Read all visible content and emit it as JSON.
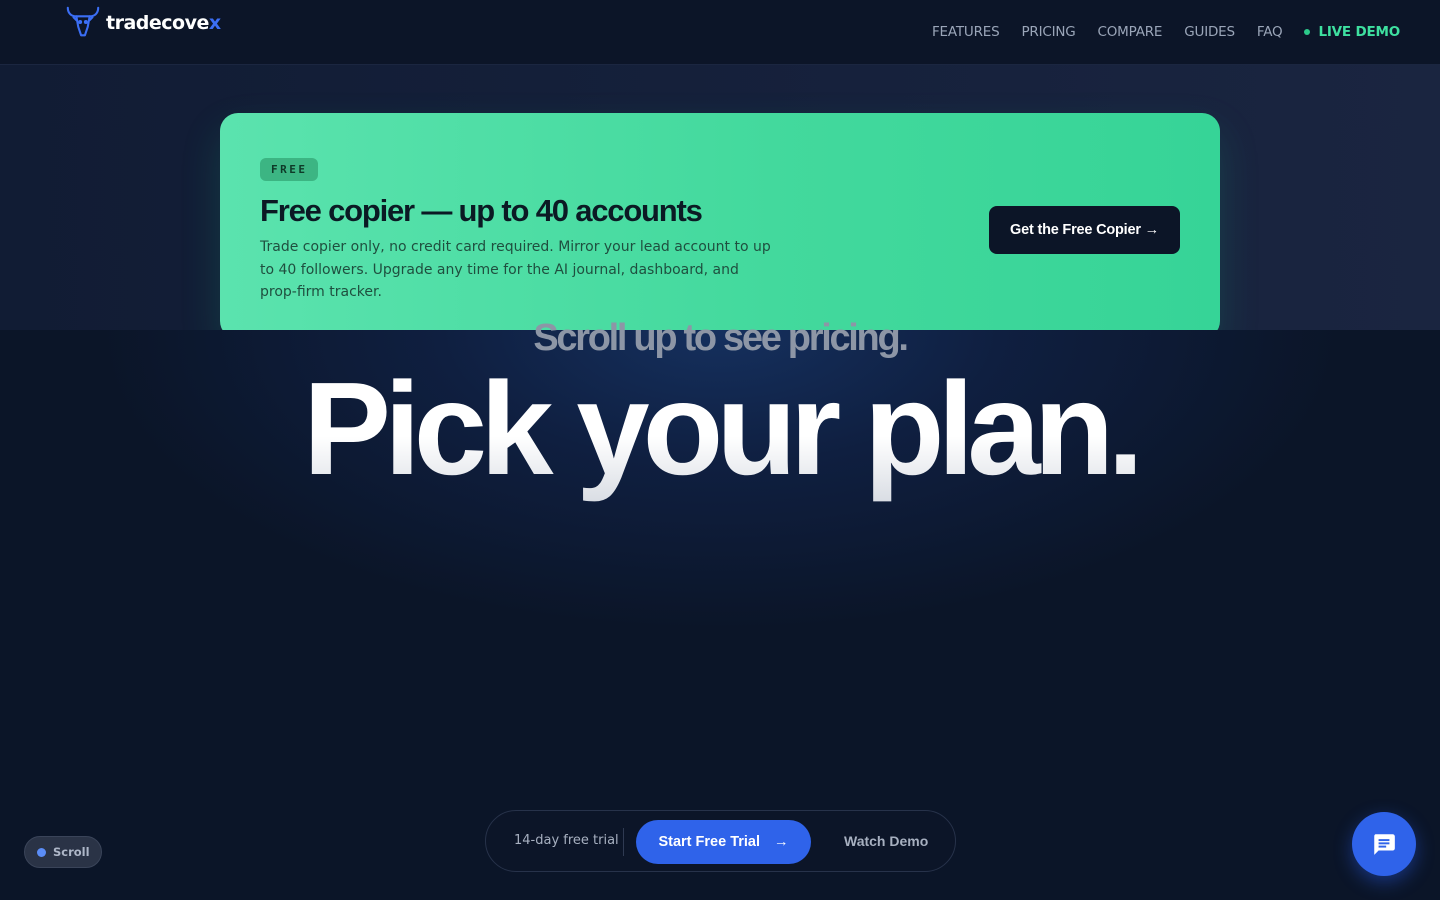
{
  "header": {
    "logo_text_main": "tradecove",
    "logo_text_accent": "x",
    "nav": {
      "features": "FEATURES",
      "pricing": "PRICING",
      "compare": "COMPARE",
      "guides": "GUIDES",
      "faq": "FAQ",
      "live_demo": "LIVE DEMO"
    }
  },
  "free_card": {
    "badge": "FREE",
    "title": "Free copier — up to 40 accounts",
    "description": "Trade copier only, no credit card required. Mirror your lead account to up to 40 followers. Upgrade any time for the AI journal, dashboard, and prop-firm tracker.",
    "button_label": "Get the Free Copier →"
  },
  "hero": {
    "scroll_hint": "Scroll up to see pricing.",
    "title": "Pick your plan."
  },
  "cta": {
    "trial_text": "14-day free trial",
    "start_label": "Start Free Trial",
    "start_arrow": "→",
    "watch_label": "Watch Demo"
  },
  "scroll_indicator": {
    "label": "Scroll"
  },
  "icons": {
    "logo": "bull-head-icon",
    "live_status": "status-dot-icon",
    "chat": "chat-bubble-icon"
  },
  "colors": {
    "brand_blue": "#2f63ea",
    "live_green": "#3ee0a0",
    "card_green": "#43d99d",
    "page_bg": "#0b1428"
  }
}
